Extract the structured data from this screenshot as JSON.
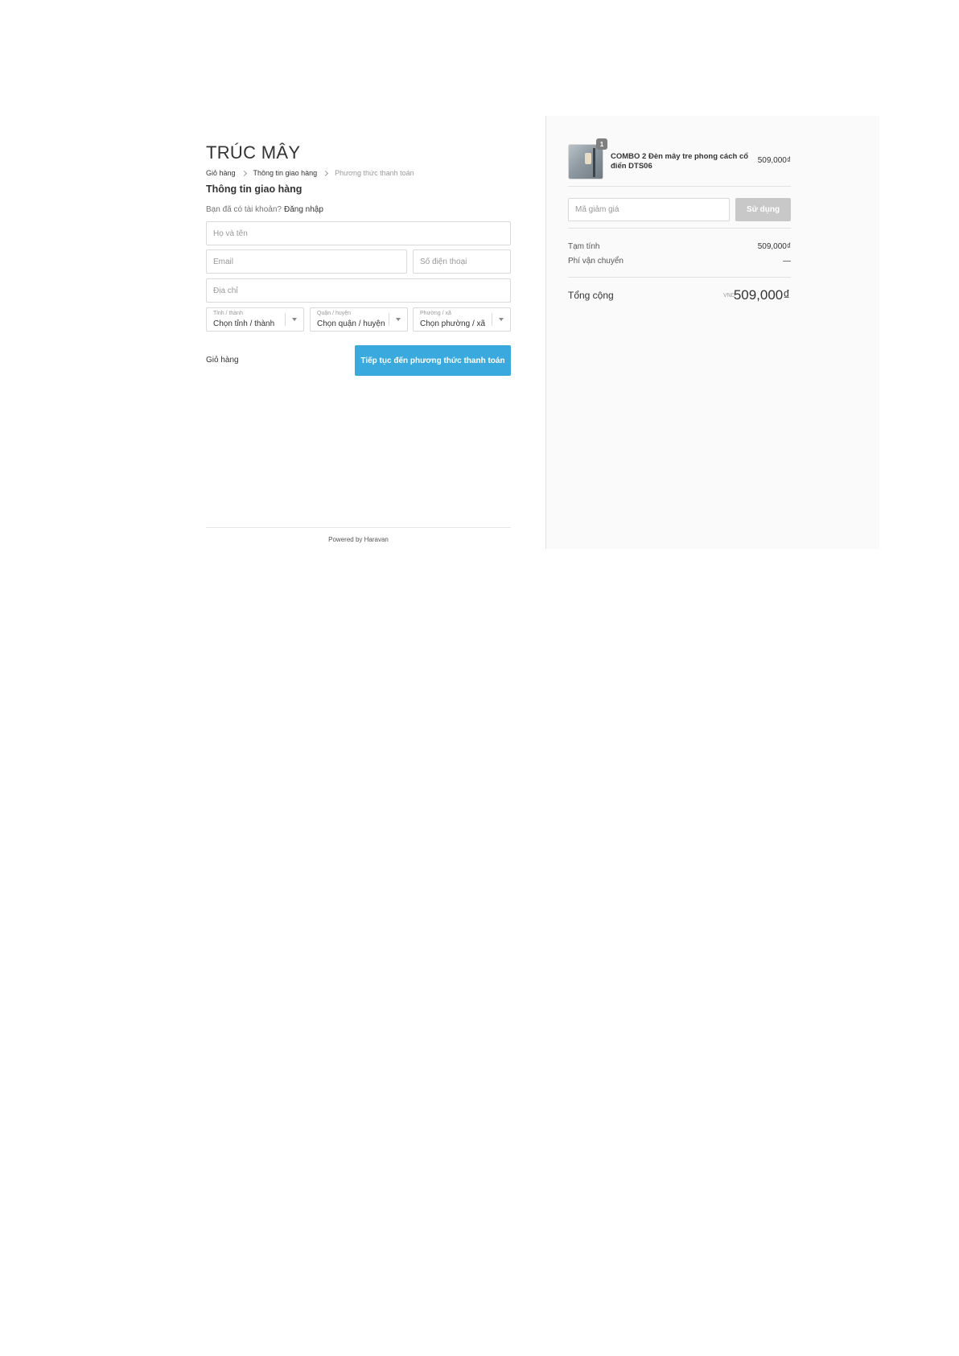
{
  "store": {
    "name": "TRÚC MÂY"
  },
  "breadcrumb": [
    {
      "label": "Giỏ hàng"
    },
    {
      "label": "Thông tin giao hàng"
    },
    {
      "label": "Phương thức thanh toán"
    }
  ],
  "shipping": {
    "title": "Thông tin giao hàng",
    "login_prompt": "Bạn đã có tài khoản?",
    "login_link": "Đăng nhập",
    "fields": {
      "name_placeholder": "Họ và tên",
      "email_placeholder": "Email",
      "phone_placeholder": "Số điện thoại",
      "address_placeholder": "Địa chỉ"
    },
    "selects": [
      {
        "label": "Tỉnh / thành",
        "value": "Chọn tỉnh / thành"
      },
      {
        "label": "Quận / huyện",
        "value": "Chọn quận / huyện"
      },
      {
        "label": "Phường / xã",
        "value": "Chọn phường / xã"
      }
    ],
    "back_link": "Giỏ hàng",
    "continue_button": "Tiếp tục đến phương thức thanh toán"
  },
  "footer": {
    "powered_by": "Powered by Haravan"
  },
  "order": {
    "product": {
      "quantity": "1",
      "name": "COMBO 2 Đèn mây tre phong cách cổ điển DTS06",
      "price": "509,000₫"
    },
    "coupon": {
      "placeholder": "Mã giảm giá",
      "button": "Sử dụng"
    },
    "subtotal_label": "Tạm tính",
    "subtotal_value": "509,000₫",
    "shipping_label": "Phí vận chuyển",
    "shipping_value": "—",
    "total_label": "Tổng cộng",
    "total_currency": "VND",
    "total_value": "509,000₫"
  },
  "colors": {
    "primary_button": "#3aa9de",
    "disabled_button": "#c8c8c8",
    "sidebar_background": "#fafafa"
  }
}
